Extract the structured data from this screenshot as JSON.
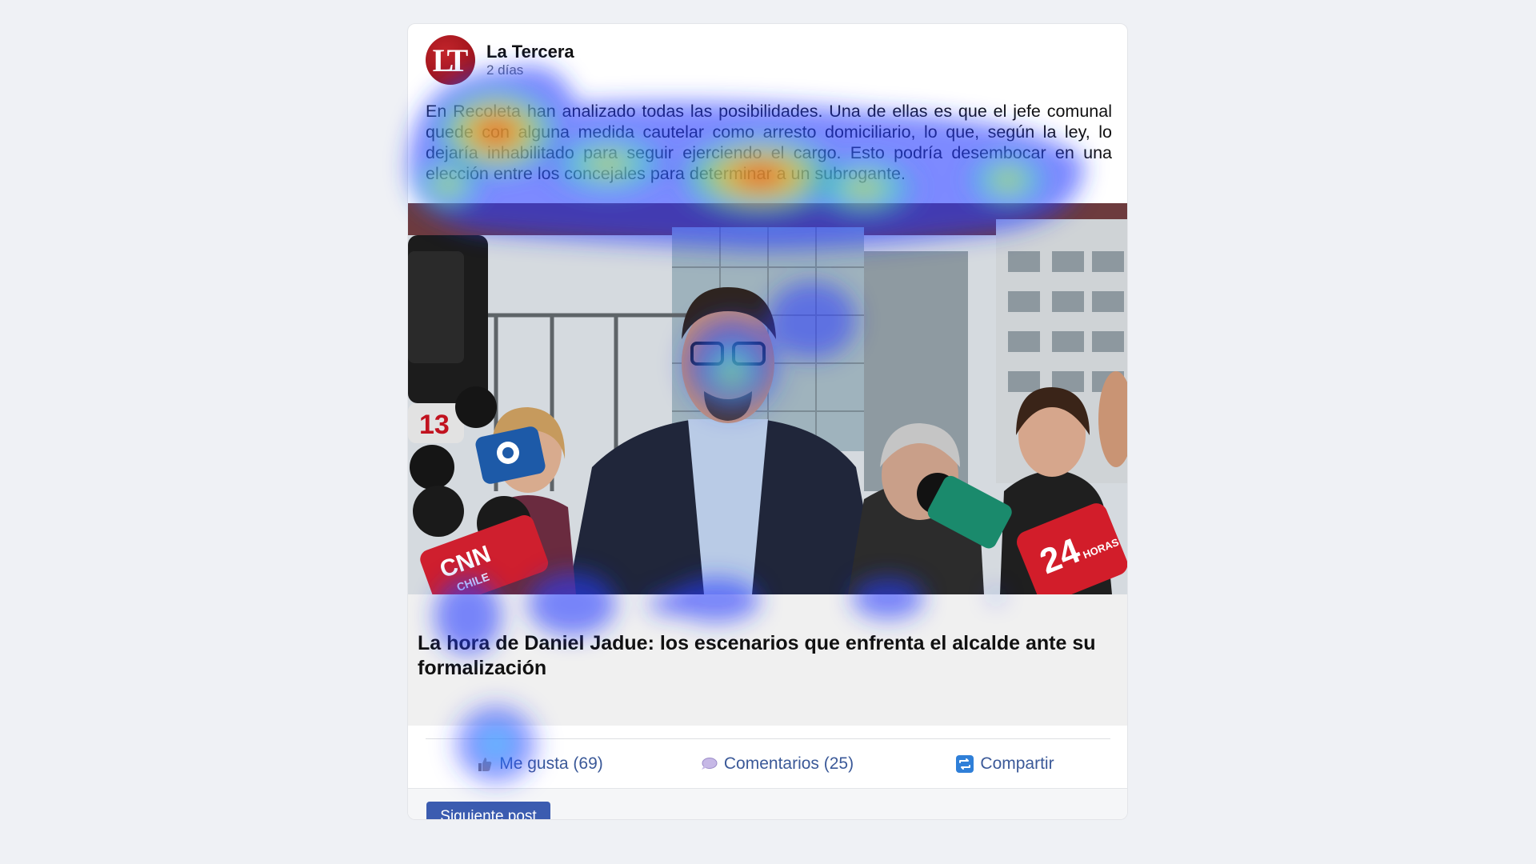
{
  "post": {
    "avatar_text": "LT",
    "source_name": "La Tercera",
    "time": "2 días",
    "text": "En Recoleta han analizado todas las posibilidades. Una de ellas es que el jefe comunal quede con alguna medida cautelar como arresto domiciliario, lo que, según la ley, lo dejaría inhabilitado para seguir ejerciendo el cargo. Esto podría desembocar en una elección entre los concejales para determinar a un subrogante.",
    "link_title": "La hora de Daniel Jadue: los escenarios que enfrenta el alcalde ante su formalización",
    "photo_mic_labels": [
      "13",
      "CNN",
      "CHILE",
      "24",
      "HORAS"
    ]
  },
  "actions": {
    "like_label": "Me gusta (69)",
    "comments_label": "Comentarios (25)",
    "share_label": "Compartir"
  },
  "footer": {
    "next_label": "Siguiente post"
  },
  "colors": {
    "page_background": "#eff1f5",
    "card_background": "#ffffff",
    "accent": "#3b5998",
    "button": "#3b5cb0",
    "avatar": "#a5171e",
    "link_box": "#f0f0f0"
  },
  "icons": {
    "like": "thumbs-up-icon",
    "comments": "speech-bubble-icon",
    "share": "share-arrows-icon"
  },
  "overlay": "attention heatmap"
}
